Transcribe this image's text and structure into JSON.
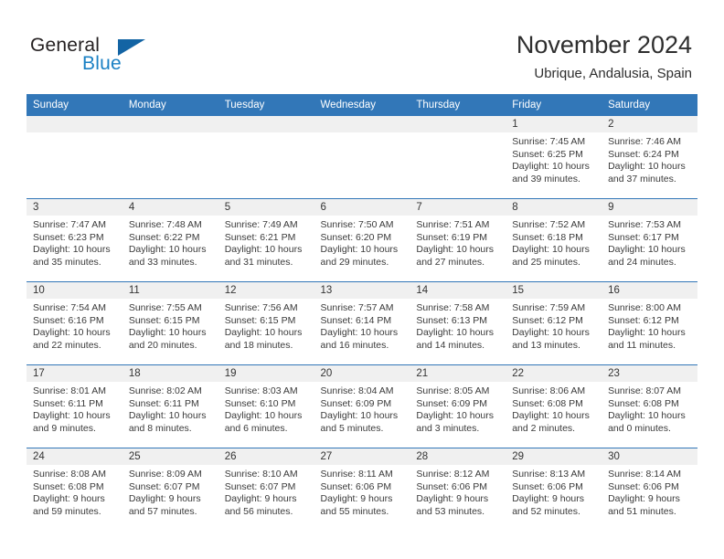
{
  "brand": {
    "name_part1": "General",
    "name_part2": "Blue",
    "triangle_color": "#1364a4",
    "blue_color": "#1a80c4"
  },
  "header": {
    "title": "November 2024",
    "subtitle": "Ubrique, Andalusia, Spain"
  },
  "calendar": {
    "accent_color": "#3277b8",
    "day_headers": [
      "Sunday",
      "Monday",
      "Tuesday",
      "Wednesday",
      "Thursday",
      "Friday",
      "Saturday"
    ],
    "weeks": [
      [
        {
          "date": "",
          "sunrise": "",
          "sunset": "",
          "daylight": ""
        },
        {
          "date": "",
          "sunrise": "",
          "sunset": "",
          "daylight": ""
        },
        {
          "date": "",
          "sunrise": "",
          "sunset": "",
          "daylight": ""
        },
        {
          "date": "",
          "sunrise": "",
          "sunset": "",
          "daylight": ""
        },
        {
          "date": "",
          "sunrise": "",
          "sunset": "",
          "daylight": ""
        },
        {
          "date": "1",
          "sunrise": "Sunrise: 7:45 AM",
          "sunset": "Sunset: 6:25 PM",
          "daylight": "Daylight: 10 hours and 39 minutes."
        },
        {
          "date": "2",
          "sunrise": "Sunrise: 7:46 AM",
          "sunset": "Sunset: 6:24 PM",
          "daylight": "Daylight: 10 hours and 37 minutes."
        }
      ],
      [
        {
          "date": "3",
          "sunrise": "Sunrise: 7:47 AM",
          "sunset": "Sunset: 6:23 PM",
          "daylight": "Daylight: 10 hours and 35 minutes."
        },
        {
          "date": "4",
          "sunrise": "Sunrise: 7:48 AM",
          "sunset": "Sunset: 6:22 PM",
          "daylight": "Daylight: 10 hours and 33 minutes."
        },
        {
          "date": "5",
          "sunrise": "Sunrise: 7:49 AM",
          "sunset": "Sunset: 6:21 PM",
          "daylight": "Daylight: 10 hours and 31 minutes."
        },
        {
          "date": "6",
          "sunrise": "Sunrise: 7:50 AM",
          "sunset": "Sunset: 6:20 PM",
          "daylight": "Daylight: 10 hours and 29 minutes."
        },
        {
          "date": "7",
          "sunrise": "Sunrise: 7:51 AM",
          "sunset": "Sunset: 6:19 PM",
          "daylight": "Daylight: 10 hours and 27 minutes."
        },
        {
          "date": "8",
          "sunrise": "Sunrise: 7:52 AM",
          "sunset": "Sunset: 6:18 PM",
          "daylight": "Daylight: 10 hours and 25 minutes."
        },
        {
          "date": "9",
          "sunrise": "Sunrise: 7:53 AM",
          "sunset": "Sunset: 6:17 PM",
          "daylight": "Daylight: 10 hours and 24 minutes."
        }
      ],
      [
        {
          "date": "10",
          "sunrise": "Sunrise: 7:54 AM",
          "sunset": "Sunset: 6:16 PM",
          "daylight": "Daylight: 10 hours and 22 minutes."
        },
        {
          "date": "11",
          "sunrise": "Sunrise: 7:55 AM",
          "sunset": "Sunset: 6:15 PM",
          "daylight": "Daylight: 10 hours and 20 minutes."
        },
        {
          "date": "12",
          "sunrise": "Sunrise: 7:56 AM",
          "sunset": "Sunset: 6:15 PM",
          "daylight": "Daylight: 10 hours and 18 minutes."
        },
        {
          "date": "13",
          "sunrise": "Sunrise: 7:57 AM",
          "sunset": "Sunset: 6:14 PM",
          "daylight": "Daylight: 10 hours and 16 minutes."
        },
        {
          "date": "14",
          "sunrise": "Sunrise: 7:58 AM",
          "sunset": "Sunset: 6:13 PM",
          "daylight": "Daylight: 10 hours and 14 minutes."
        },
        {
          "date": "15",
          "sunrise": "Sunrise: 7:59 AM",
          "sunset": "Sunset: 6:12 PM",
          "daylight": "Daylight: 10 hours and 13 minutes."
        },
        {
          "date": "16",
          "sunrise": "Sunrise: 8:00 AM",
          "sunset": "Sunset: 6:12 PM",
          "daylight": "Daylight: 10 hours and 11 minutes."
        }
      ],
      [
        {
          "date": "17",
          "sunrise": "Sunrise: 8:01 AM",
          "sunset": "Sunset: 6:11 PM",
          "daylight": "Daylight: 10 hours and 9 minutes."
        },
        {
          "date": "18",
          "sunrise": "Sunrise: 8:02 AM",
          "sunset": "Sunset: 6:11 PM",
          "daylight": "Daylight: 10 hours and 8 minutes."
        },
        {
          "date": "19",
          "sunrise": "Sunrise: 8:03 AM",
          "sunset": "Sunset: 6:10 PM",
          "daylight": "Daylight: 10 hours and 6 minutes."
        },
        {
          "date": "20",
          "sunrise": "Sunrise: 8:04 AM",
          "sunset": "Sunset: 6:09 PM",
          "daylight": "Daylight: 10 hours and 5 minutes."
        },
        {
          "date": "21",
          "sunrise": "Sunrise: 8:05 AM",
          "sunset": "Sunset: 6:09 PM",
          "daylight": "Daylight: 10 hours and 3 minutes."
        },
        {
          "date": "22",
          "sunrise": "Sunrise: 8:06 AM",
          "sunset": "Sunset: 6:08 PM",
          "daylight": "Daylight: 10 hours and 2 minutes."
        },
        {
          "date": "23",
          "sunrise": "Sunrise: 8:07 AM",
          "sunset": "Sunset: 6:08 PM",
          "daylight": "Daylight: 10 hours and 0 minutes."
        }
      ],
      [
        {
          "date": "24",
          "sunrise": "Sunrise: 8:08 AM",
          "sunset": "Sunset: 6:08 PM",
          "daylight": "Daylight: 9 hours and 59 minutes."
        },
        {
          "date": "25",
          "sunrise": "Sunrise: 8:09 AM",
          "sunset": "Sunset: 6:07 PM",
          "daylight": "Daylight: 9 hours and 57 minutes."
        },
        {
          "date": "26",
          "sunrise": "Sunrise: 8:10 AM",
          "sunset": "Sunset: 6:07 PM",
          "daylight": "Daylight: 9 hours and 56 minutes."
        },
        {
          "date": "27",
          "sunrise": "Sunrise: 8:11 AM",
          "sunset": "Sunset: 6:06 PM",
          "daylight": "Daylight: 9 hours and 55 minutes."
        },
        {
          "date": "28",
          "sunrise": "Sunrise: 8:12 AM",
          "sunset": "Sunset: 6:06 PM",
          "daylight": "Daylight: 9 hours and 53 minutes."
        },
        {
          "date": "29",
          "sunrise": "Sunrise: 8:13 AM",
          "sunset": "Sunset: 6:06 PM",
          "daylight": "Daylight: 9 hours and 52 minutes."
        },
        {
          "date": "30",
          "sunrise": "Sunrise: 8:14 AM",
          "sunset": "Sunset: 6:06 PM",
          "daylight": "Daylight: 9 hours and 51 minutes."
        }
      ]
    ]
  }
}
